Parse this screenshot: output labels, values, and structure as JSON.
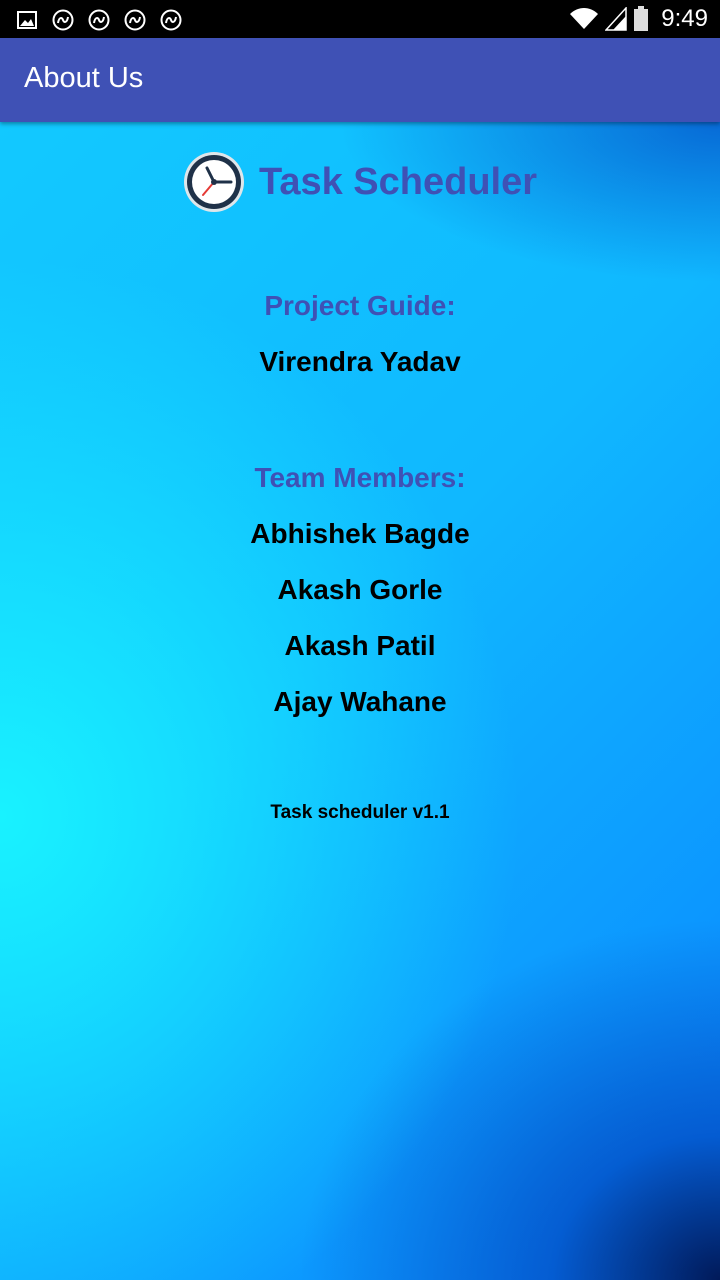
{
  "status_bar": {
    "time": "9:49",
    "notification_icons": [
      "image-icon",
      "sync-icon",
      "sync-icon",
      "sync-icon",
      "sync-icon"
    ],
    "right_icons": [
      "wifi-icon",
      "signal-icon",
      "battery-icon"
    ]
  },
  "app_bar": {
    "title": "About Us",
    "color": "#3f51b5"
  },
  "header": {
    "logo_icon": "clock-icon",
    "app_name": "Task Scheduler"
  },
  "guide": {
    "label": "Project Guide:",
    "name": "Virendra Yadav"
  },
  "team": {
    "label": "Team Members:",
    "members": [
      "Abhishek Bagde",
      "Akash Gorle",
      "Akash Patil",
      "Ajay Wahane"
    ]
  },
  "version": "Task scheduler v1.1",
  "colors": {
    "accent": "#3f51b5",
    "background_light": "#19f5ff",
    "background_dark": "#0a84ff"
  }
}
